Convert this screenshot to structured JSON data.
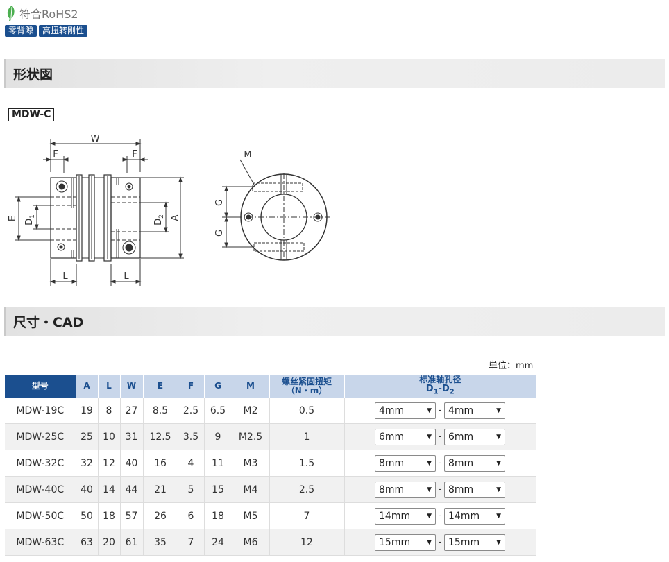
{
  "rohs": {
    "text": "符合RoHS2",
    "color": "#4caf50"
  },
  "badges": [
    "零背隙",
    "高扭转刚性"
  ],
  "sections": {
    "shape": "形状図",
    "dims": "尺寸・CAD"
  },
  "model_label": "MDW-C",
  "drawing_labels": {
    "W": "W",
    "F": "F",
    "E": "E",
    "A": "A",
    "L": "L",
    "G": "G",
    "M": "M",
    "D1": "D",
    "D1_sub": "1",
    "D2": "D",
    "D2_sub": "2"
  },
  "unit": "単位：mm",
  "table": {
    "headers": {
      "model": "型号",
      "A": "A",
      "L": "L",
      "W": "W",
      "E": "E",
      "F": "F",
      "G": "G",
      "M": "M",
      "torque_1": "螺丝紧固扭矩",
      "torque_2": "（N・m）",
      "bore_1": "标准轴孔径",
      "bore_2_main": "D",
      "bore_2_sub1": "1",
      "bore_2_dash": "-D",
      "bore_2_sub2": "2"
    },
    "rows": [
      {
        "model": "MDW-19C",
        "A": "19",
        "L": "8",
        "W": "27",
        "E": "8.5",
        "F": "2.5",
        "G": "6.5",
        "M": "M2",
        "torque": "0.5",
        "d1": "4mm",
        "d2": "4mm"
      },
      {
        "model": "MDW-25C",
        "A": "25",
        "L": "10",
        "W": "31",
        "E": "12.5",
        "F": "3.5",
        "G": "9",
        "M": "M2.5",
        "torque": "1",
        "d1": "6mm",
        "d2": "6mm"
      },
      {
        "model": "MDW-32C",
        "A": "32",
        "L": "12",
        "W": "40",
        "E": "16",
        "F": "4",
        "G": "11",
        "M": "M3",
        "torque": "1.5",
        "d1": "8mm",
        "d2": "8mm"
      },
      {
        "model": "MDW-40C",
        "A": "40",
        "L": "14",
        "W": "44",
        "E": "21",
        "F": "5",
        "G": "15",
        "M": "M4",
        "torque": "2.5",
        "d1": "8mm",
        "d2": "8mm"
      },
      {
        "model": "MDW-50C",
        "A": "50",
        "L": "18",
        "W": "57",
        "E": "26",
        "F": "6",
        "G": "18",
        "M": "M5",
        "torque": "7",
        "d1": "14mm",
        "d2": "14mm"
      },
      {
        "model": "MDW-63C",
        "A": "63",
        "L": "20",
        "W": "61",
        "E": "35",
        "F": "7",
        "G": "24",
        "M": "M6",
        "torque": "12",
        "d1": "15mm",
        "d2": "15mm"
      }
    ],
    "dash": "-",
    "arrow": "▼"
  },
  "colors": {
    "brand": "#1b4f8f",
    "header_bg": "#c8d6ea"
  }
}
